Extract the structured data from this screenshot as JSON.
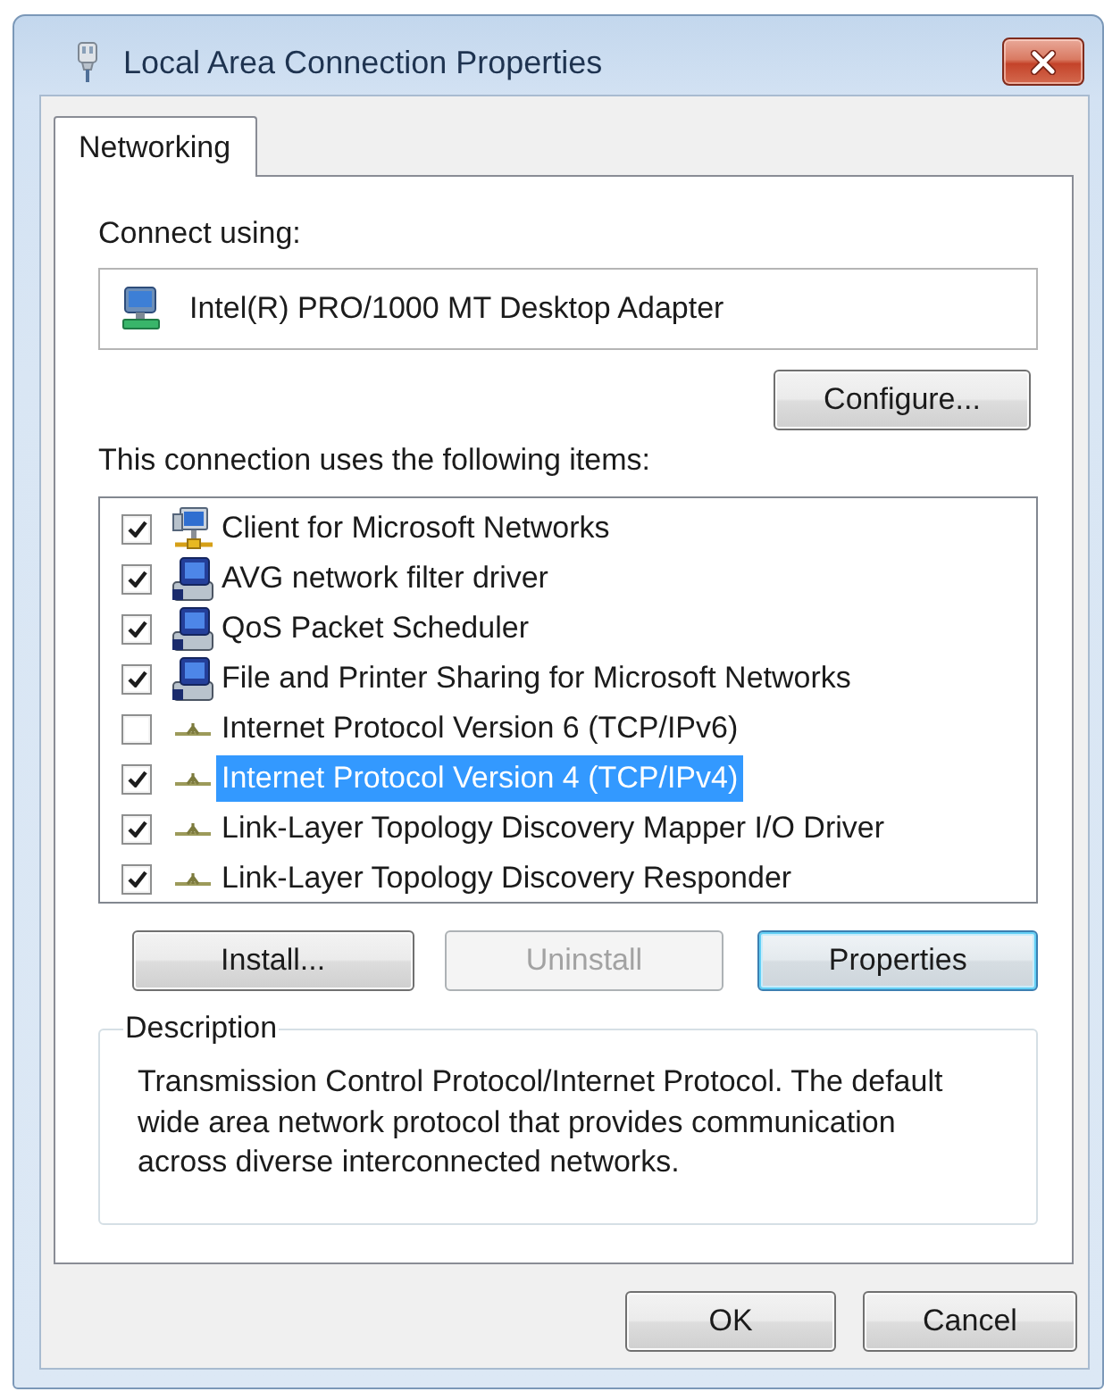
{
  "window": {
    "title": "Local Area Connection Properties"
  },
  "tabs": [
    {
      "label": "Networking",
      "selected": true
    }
  ],
  "connect_using": {
    "label": "Connect using:",
    "adapter": "Intel(R) PRO/1000 MT Desktop Adapter"
  },
  "configure_button": {
    "label": "Configure..."
  },
  "items_label": "This connection uses the following items:",
  "items": [
    {
      "kind": "client",
      "name": "Client for Microsoft Networks",
      "checked": true,
      "selected": false
    },
    {
      "kind": "service",
      "name": "AVG network filter driver",
      "checked": true,
      "selected": false
    },
    {
      "kind": "service",
      "name": "QoS Packet Scheduler",
      "checked": true,
      "selected": false
    },
    {
      "kind": "service",
      "name": "File and Printer Sharing for Microsoft Networks",
      "checked": true,
      "selected": false
    },
    {
      "kind": "protocol",
      "name": "Internet Protocol Version 6 (TCP/IPv6)",
      "checked": false,
      "selected": false
    },
    {
      "kind": "protocol",
      "name": "Internet Protocol Version 4 (TCP/IPv4)",
      "checked": true,
      "selected": true
    },
    {
      "kind": "protocol",
      "name": "Link-Layer Topology Discovery Mapper I/O Driver",
      "checked": true,
      "selected": false
    },
    {
      "kind": "protocol",
      "name": "Link-Layer Topology Discovery Responder",
      "checked": true,
      "selected": false
    }
  ],
  "item_buttons": [
    {
      "label": "Install...",
      "disabled": false,
      "default": false
    },
    {
      "label": "Uninstall",
      "disabled": true,
      "default": false
    },
    {
      "label": "Properties",
      "disabled": false,
      "default": true
    }
  ],
  "description": {
    "label": "Description",
    "text": "Transmission Control Protocol/Internet Protocol. The default wide area network protocol that provides communication across diverse interconnected networks."
  },
  "dialog_buttons": [
    {
      "label": "OK"
    },
    {
      "label": "Cancel"
    }
  ]
}
